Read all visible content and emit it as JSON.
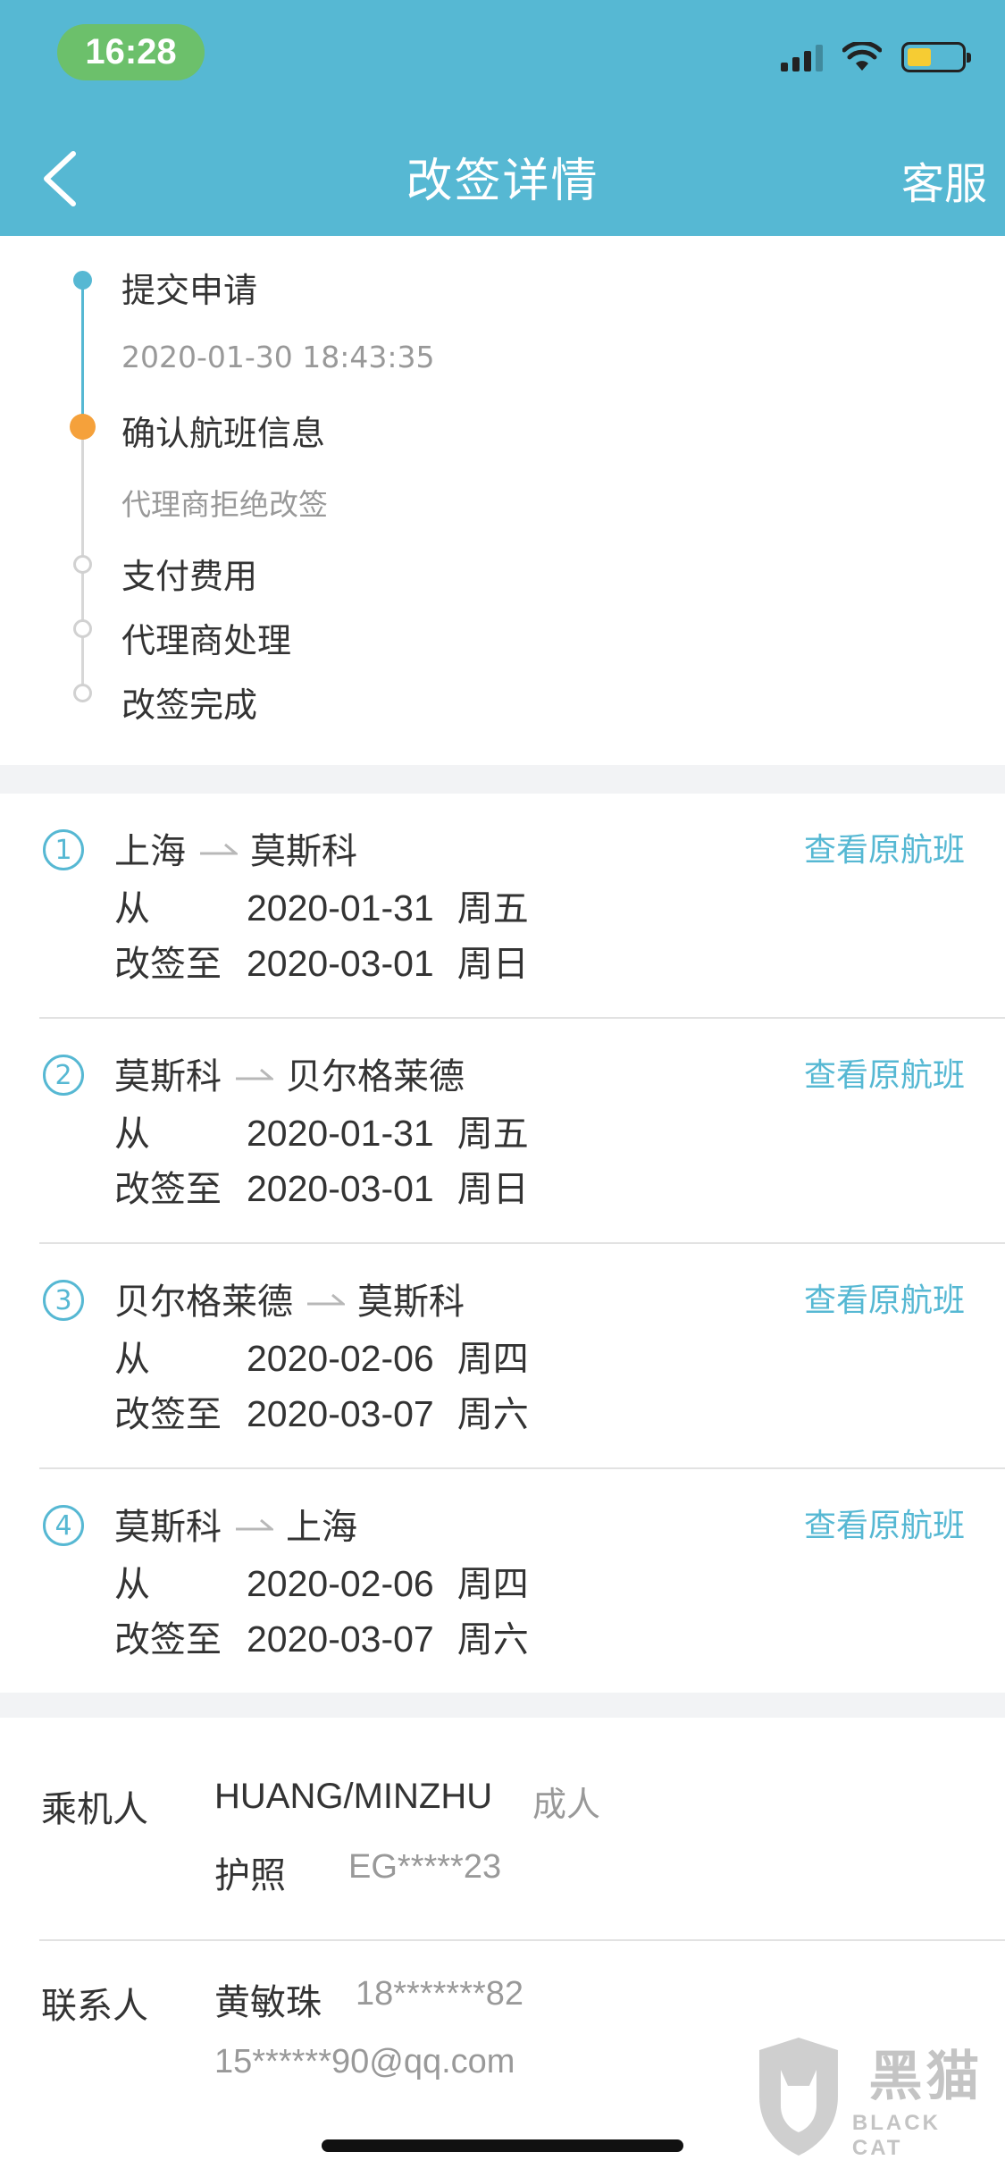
{
  "status_bar": {
    "time": "16:28"
  },
  "header": {
    "title": "改签详情",
    "service": "客服"
  },
  "progress": {
    "steps": [
      {
        "label": "提交申请",
        "sub": "2020-01-30 18:43:35"
      },
      {
        "label": "确认航班信息",
        "sub": "代理商拒绝改签"
      },
      {
        "label": "支付费用"
      },
      {
        "label": "代理商处理"
      },
      {
        "label": "改签完成"
      }
    ]
  },
  "flights": {
    "from_label": "从",
    "change_label": "改签至",
    "view_label": "查看原航班",
    "segments": [
      {
        "num": "1",
        "origin": "上海",
        "dest": "莫斯科",
        "from_date": "2020-01-31",
        "from_day": "周五",
        "to_date": "2020-03-01",
        "to_day": "周日"
      },
      {
        "num": "2",
        "origin": "莫斯科",
        "dest": "贝尔格莱德",
        "from_date": "2020-01-31",
        "from_day": "周五",
        "to_date": "2020-03-01",
        "to_day": "周日"
      },
      {
        "num": "3",
        "origin": "贝尔格莱德",
        "dest": "莫斯科",
        "from_date": "2020-02-06",
        "from_day": "周四",
        "to_date": "2020-03-07",
        "to_day": "周六"
      },
      {
        "num": "4",
        "origin": "莫斯科",
        "dest": "上海",
        "from_date": "2020-02-06",
        "from_day": "周四",
        "to_date": "2020-03-07",
        "to_day": "周六"
      }
    ]
  },
  "passenger": {
    "label": "乘机人",
    "name": "HUANG/MINZHU",
    "type": "成人",
    "doc_label": "护照",
    "doc_number": "EG*****23"
  },
  "contact": {
    "label": "联系人",
    "name": "黄敏珠",
    "phone": "18*******82",
    "email": "15******90@qq.com"
  },
  "watermark": {
    "big": "黑猫",
    "small": "BLACK CAT"
  },
  "colors": {
    "header": "#56b8d3",
    "accent": "#56b8d3",
    "current_step": "#f5a13b",
    "time_pill": "#6cc06b"
  }
}
